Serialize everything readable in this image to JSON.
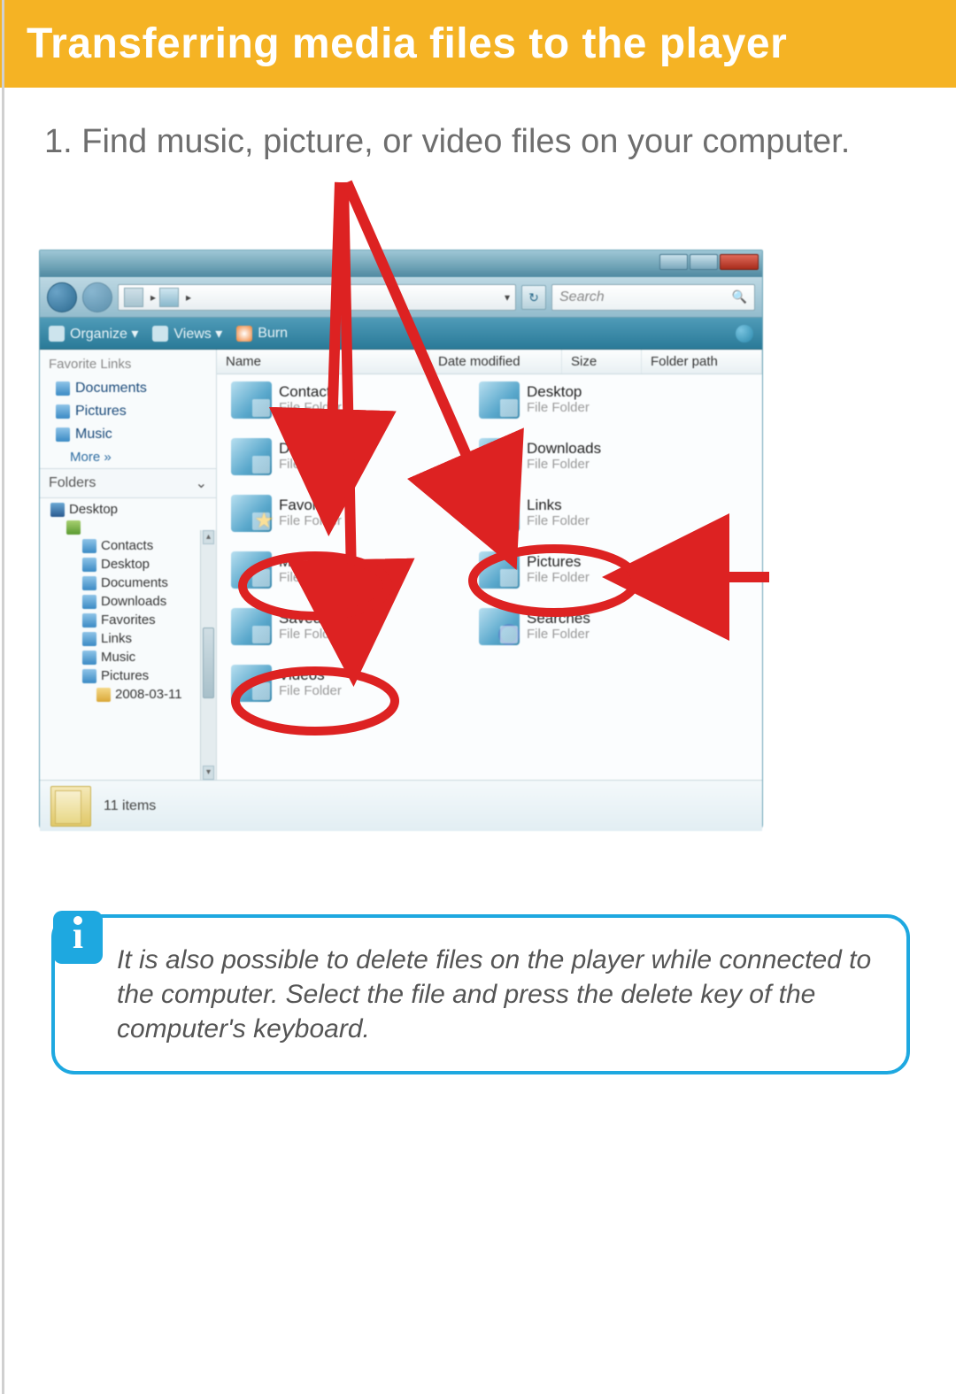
{
  "banner_title": "Transferring media files to the player",
  "step_text": "1. Find music, picture, or video files on your computer.",
  "window": {
    "search_placeholder": "Search",
    "toolbar": {
      "organize": "Organize ▾",
      "views": "Views ▾",
      "burn": "Burn"
    },
    "favorite_links_header": "Favorite Links",
    "favorite_links": {
      "documents": "Documents",
      "pictures": "Pictures",
      "music": "Music",
      "more": "More »"
    },
    "folders_header": "Folders",
    "tree": {
      "desktop": "Desktop",
      "contacts": "Contacts",
      "desktop2": "Desktop",
      "documents": "Documents",
      "downloads": "Downloads",
      "favorites": "Favorites",
      "links": "Links",
      "music": "Music",
      "pictures": "Pictures",
      "date_folder": "2008-03-11"
    },
    "columns": {
      "name": "Name",
      "date": "Date modified",
      "size": "Size",
      "path": "Folder path"
    },
    "items": {
      "contacts": {
        "name": "Contacts",
        "sub": "File Folder"
      },
      "desktop": {
        "name": "Desktop",
        "sub": "File Folder"
      },
      "documents": {
        "name": "Documents",
        "sub": "File Folder"
      },
      "downloads": {
        "name": "Downloads",
        "sub": "File Folder"
      },
      "favorites": {
        "name": "Favorites",
        "sub": "File Folder"
      },
      "links": {
        "name": "Links",
        "sub": "File Folder"
      },
      "music": {
        "name": "Music",
        "sub": "File Folder"
      },
      "pictures": {
        "name": "Pictures",
        "sub": "File Folder"
      },
      "savedgames": {
        "name": "Saved Games",
        "sub": "File Folder"
      },
      "searches": {
        "name": "Searches",
        "sub": "File Folder"
      },
      "videos": {
        "name": "Videos",
        "sub": "File Folder"
      }
    },
    "details_text": "11 items"
  },
  "info_text": "It is also possible to delete files on the player while connected to the computer. Select the file and press the delete key of the computer's keyboard."
}
